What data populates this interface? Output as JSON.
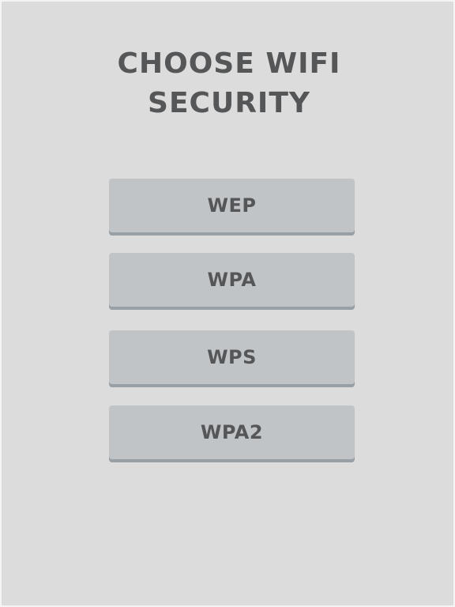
{
  "title": {
    "line1": "CHOOSE WIFI",
    "line2": "SECURITY"
  },
  "options": [
    {
      "label": "WEP"
    },
    {
      "label": "WPA"
    },
    {
      "label": "WPS"
    },
    {
      "label": "WPA2"
    }
  ],
  "colors": {
    "background": "#dcdcdc",
    "button": "#c0c4c7",
    "button_shadow": "#989fa5",
    "text": "#555658"
  }
}
